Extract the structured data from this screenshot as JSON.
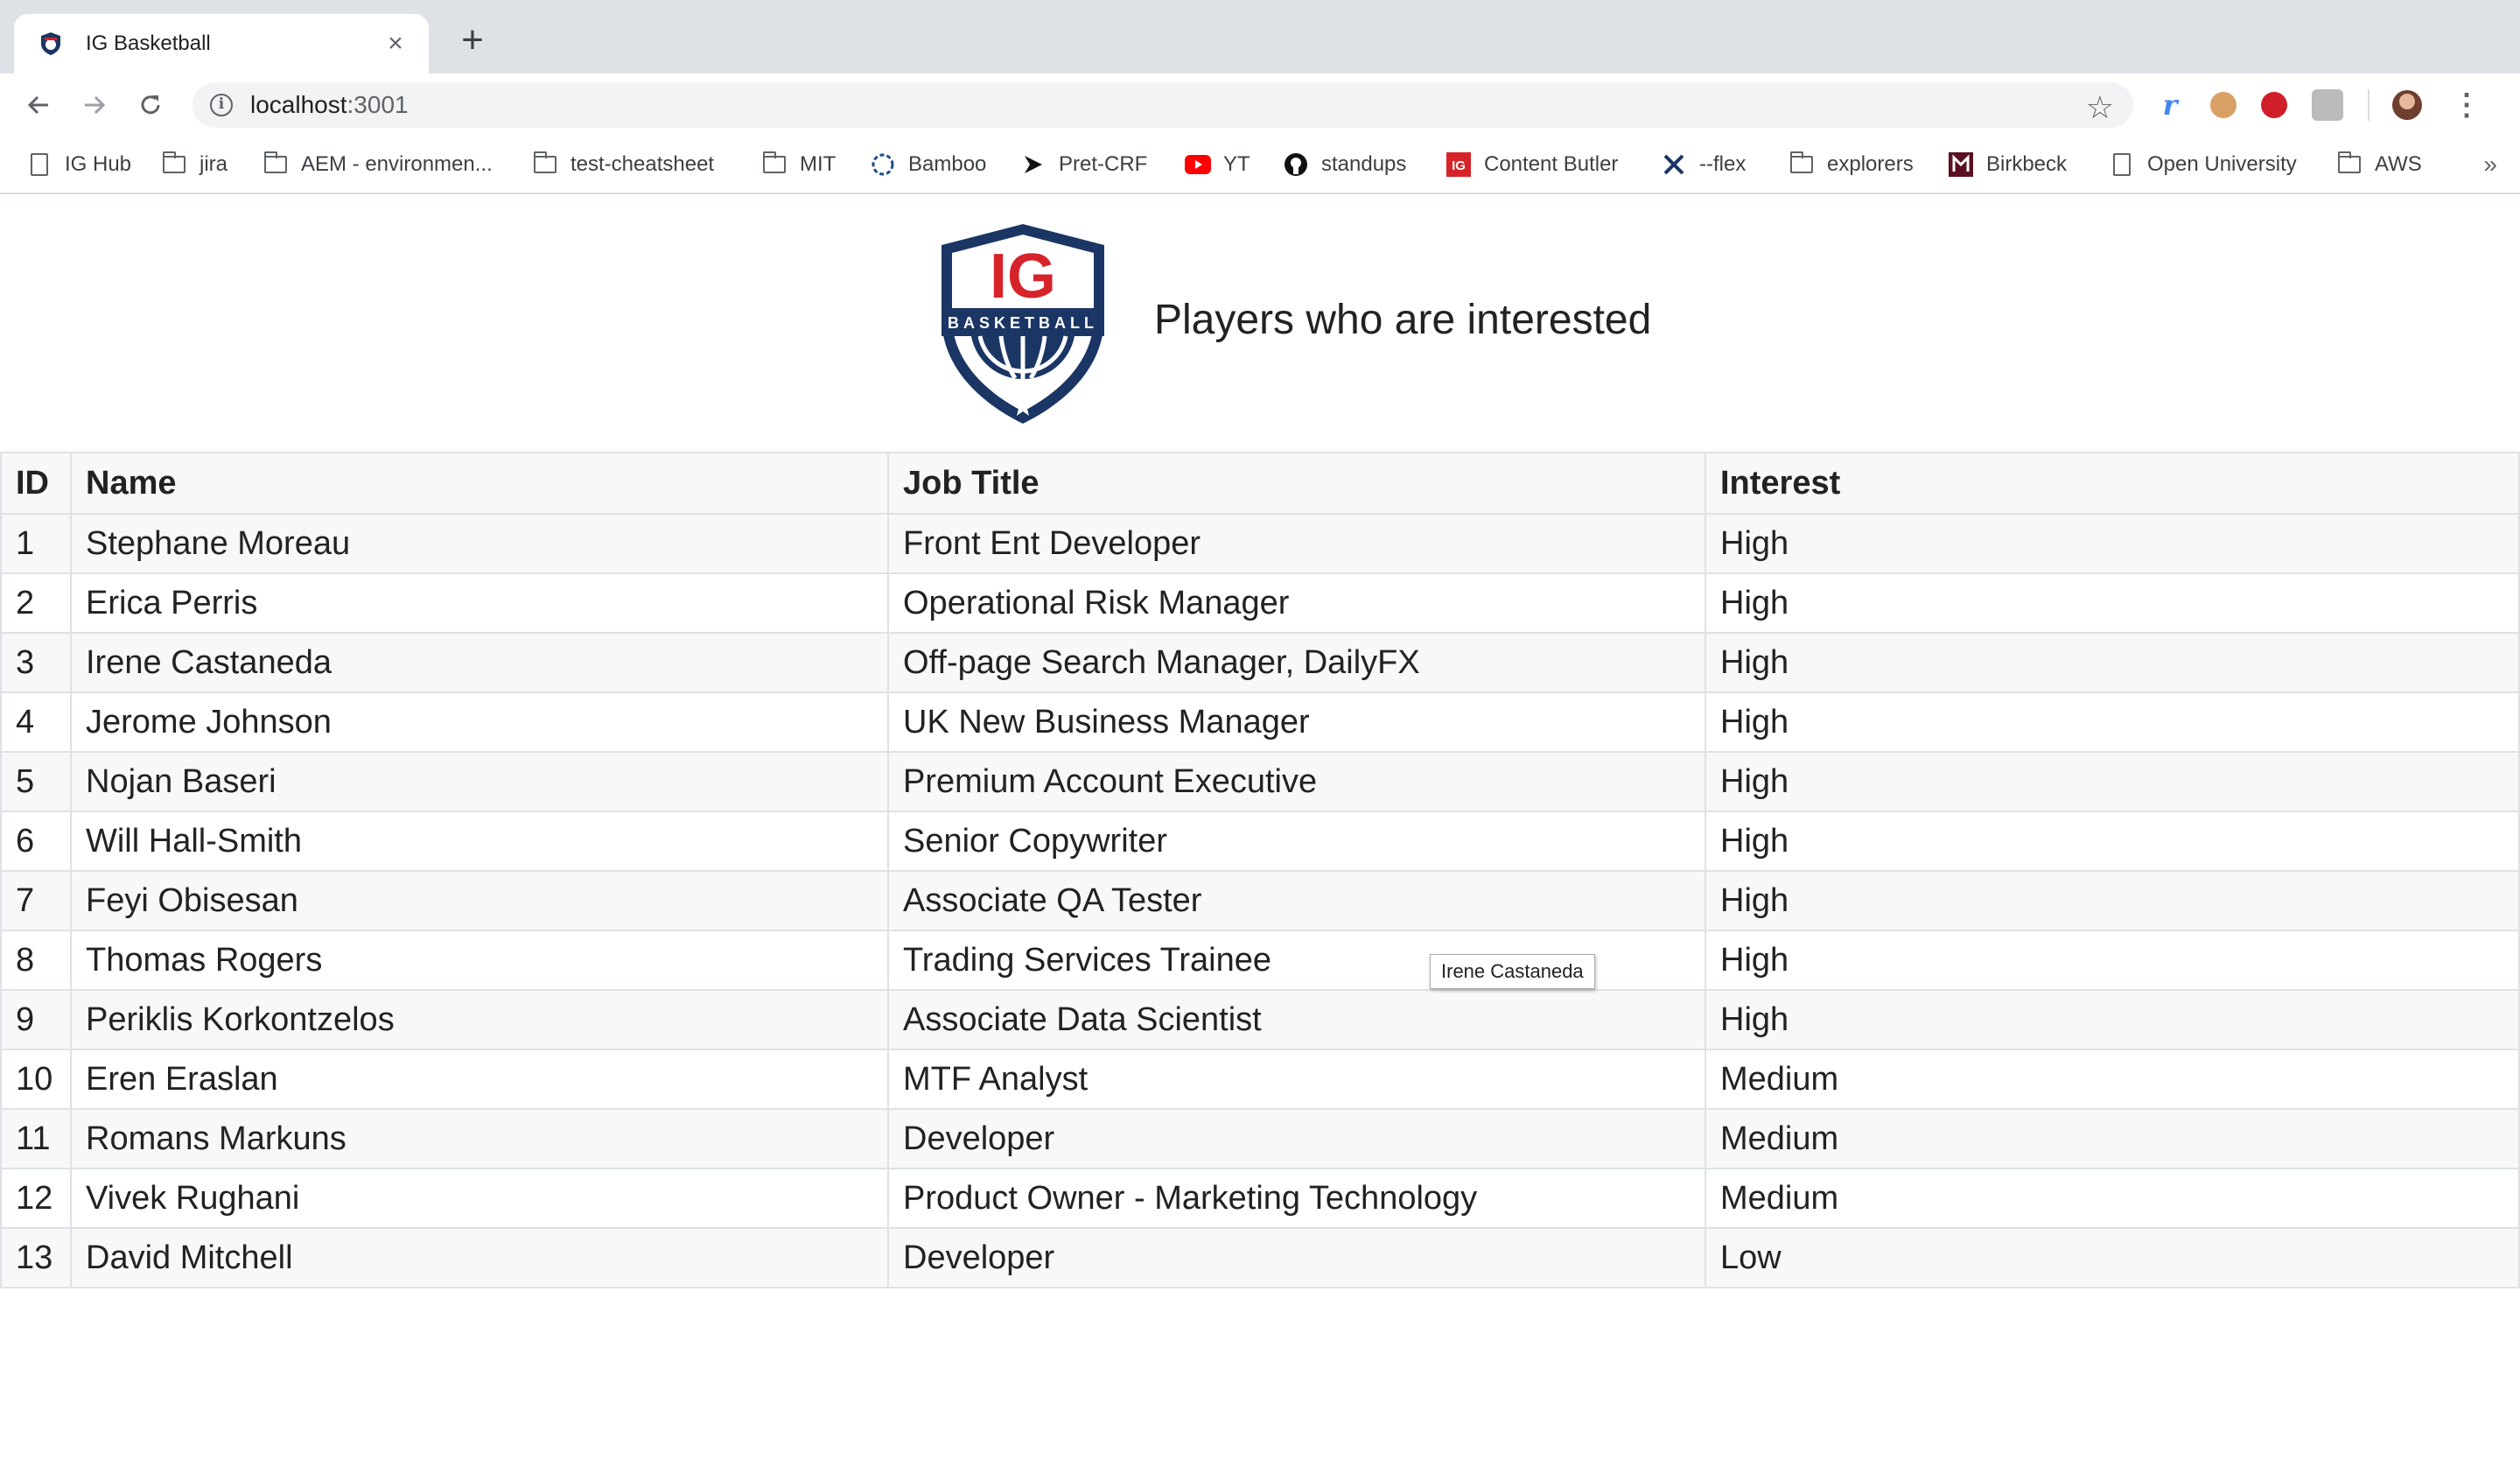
{
  "browser": {
    "tab_title": "IG Basketball",
    "tab_close": "×",
    "new_tab": "+",
    "url_host": "localhost",
    "url_port": ":3001",
    "bookmarks": [
      {
        "label": "IG Hub",
        "icon": "page-icon"
      },
      {
        "label": "jira",
        "icon": "folder-icon"
      },
      {
        "label": "AEM - environmen...",
        "icon": "folder-icon"
      },
      {
        "label": "test-cheatsheet",
        "icon": "folder-icon"
      },
      {
        "label": "MIT",
        "icon": "folder-icon"
      },
      {
        "label": "Bamboo",
        "icon": "bamboo-icon"
      },
      {
        "label": "Pret-CRF",
        "icon": "chevron-icon"
      },
      {
        "label": "YT",
        "icon": "youtube-icon"
      },
      {
        "label": "standups",
        "icon": "github-icon"
      },
      {
        "label": "Content Butler",
        "icon": "ig-icon"
      },
      {
        "label": "--flex",
        "icon": "x-icon"
      },
      {
        "label": "explorers",
        "icon": "folder-icon"
      },
      {
        "label": "Birkbeck",
        "icon": "birkbeck-icon"
      },
      {
        "label": "Open University",
        "icon": "page-icon"
      },
      {
        "label": "AWS",
        "icon": "folder-icon"
      }
    ],
    "bookmarks_more": "»"
  },
  "header": {
    "logo_text_top": "IG",
    "logo_text_band": "BASKETBALL",
    "title": "Players who are interested"
  },
  "table": {
    "columns": [
      "ID",
      "Name",
      "Job Title",
      "Interest"
    ],
    "rows": [
      {
        "id": "1",
        "name": "Stephane Moreau",
        "job": "Front Ent Developer",
        "interest": "High"
      },
      {
        "id": "2",
        "name": "Erica Perris",
        "job": "Operational Risk Manager",
        "interest": "High"
      },
      {
        "id": "3",
        "name": "Irene Castaneda",
        "job": "Off-page Search Manager, DailyFX",
        "interest": "High"
      },
      {
        "id": "4",
        "name": "Jerome Johnson",
        "job": "UK New Business Manager",
        "interest": "High"
      },
      {
        "id": "5",
        "name": "Nojan Baseri",
        "job": "Premium Account Executive",
        "interest": "High"
      },
      {
        "id": "6",
        "name": "Will Hall-Smith",
        "job": "Senior Copywriter",
        "interest": "High"
      },
      {
        "id": "7",
        "name": "Feyi Obisesan",
        "job": "Associate QA Tester",
        "interest": "High"
      },
      {
        "id": "8",
        "name": "Thomas Rogers",
        "job": "Trading Services Trainee",
        "interest": "High"
      },
      {
        "id": "9",
        "name": "Periklis Korkontzelos",
        "job": "Associate Data Scientist",
        "interest": "High"
      },
      {
        "id": "10",
        "name": "Eren Eraslan",
        "job": "MTF Analyst",
        "interest": "Medium"
      },
      {
        "id": "11",
        "name": "Romans Markuns",
        "job": "Developer",
        "interest": "Medium"
      },
      {
        "id": "12",
        "name": "Vivek Rughani",
        "job": "Product Owner - Marketing Technology",
        "interest": "Medium"
      },
      {
        "id": "13",
        "name": "David Mitchell",
        "job": "Developer",
        "interest": "Low"
      }
    ]
  },
  "tooltip": "Irene Castaneda",
  "colors": {
    "brand_navy": "#1b3664",
    "brand_red": "#d6232a",
    "row_stripe": "#f8f8f8",
    "border": "#dee2e6"
  }
}
